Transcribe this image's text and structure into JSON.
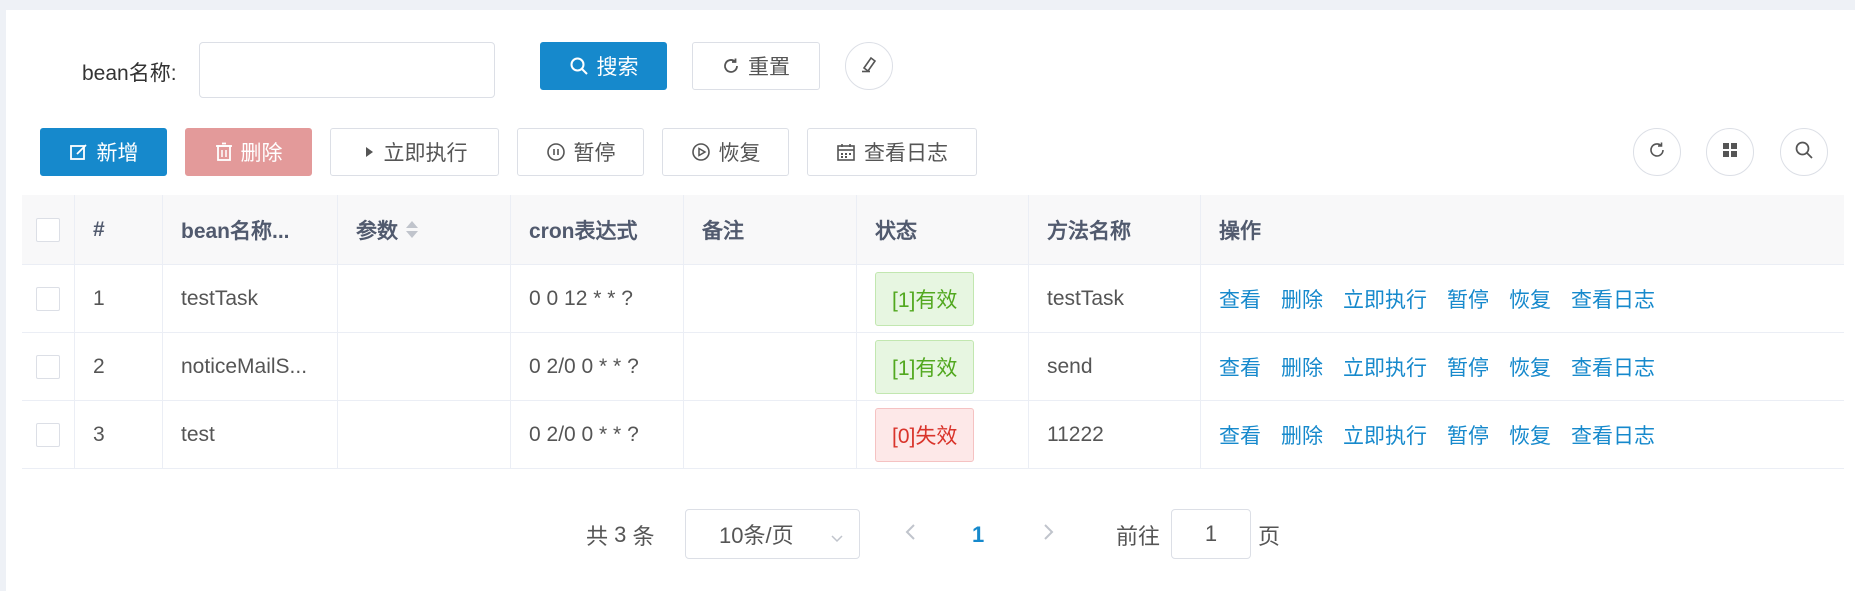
{
  "search": {
    "label": "bean名称:",
    "value": "",
    "placeholder": "",
    "search_button": "搜索",
    "reset_button": "重置"
  },
  "toolbar": {
    "add": "新增",
    "delete": "删除",
    "run_now": "立即执行",
    "pause": "暂停",
    "resume": "恢复",
    "view_log": "查看日志"
  },
  "table": {
    "headers": [
      "#",
      "bean名称...",
      "参数",
      "cron表达式",
      "备注",
      "状态",
      "方法名称",
      "操作"
    ],
    "rows": [
      {
        "index": "1",
        "bean": "testTask",
        "params": "",
        "cron": "0 0 12 * * ?",
        "remark": "",
        "status": "[1]有效",
        "status_type": "ok",
        "method": "testTask"
      },
      {
        "index": "2",
        "bean": "noticeMailS...",
        "params": "",
        "cron": "0 2/0 0 * * ?",
        "remark": "",
        "status": "[1]有效",
        "status_type": "ok",
        "method": "send"
      },
      {
        "index": "3",
        "bean": "test",
        "params": "",
        "cron": "0 2/0 0 * * ?",
        "remark": "",
        "status": "[0]失效",
        "status_type": "bad",
        "method": "11222"
      }
    ],
    "row_actions": [
      "查看",
      "删除",
      "立即执行",
      "暂停",
      "恢复",
      "查看日志"
    ]
  },
  "pagination": {
    "total_prefix": "共",
    "total": "3",
    "total_suffix": "条",
    "page_size": "10条/页",
    "current_page": "1",
    "goto_label": "前往",
    "goto_value": "1",
    "goto_suffix": "页"
  },
  "colors": {
    "primary": "#1689cc",
    "danger_light": "#e39a9a",
    "status_ok": "#52a81f",
    "status_bad": "#d9342b"
  }
}
